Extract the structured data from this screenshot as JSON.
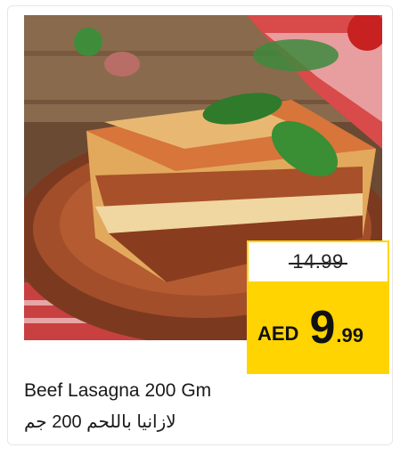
{
  "product": {
    "name_en": "Beef Lasagna 200 Gm",
    "name_ar": "لازانيا باللحم 200 جم"
  },
  "price": {
    "old": "14.99",
    "currency": "AED",
    "integer": "9",
    "decimal": ".99"
  },
  "image": {
    "subject": "lasagna-slice-on-plate"
  },
  "colors": {
    "price_tag": "#ffd400",
    "text": "#1a1a1a"
  }
}
